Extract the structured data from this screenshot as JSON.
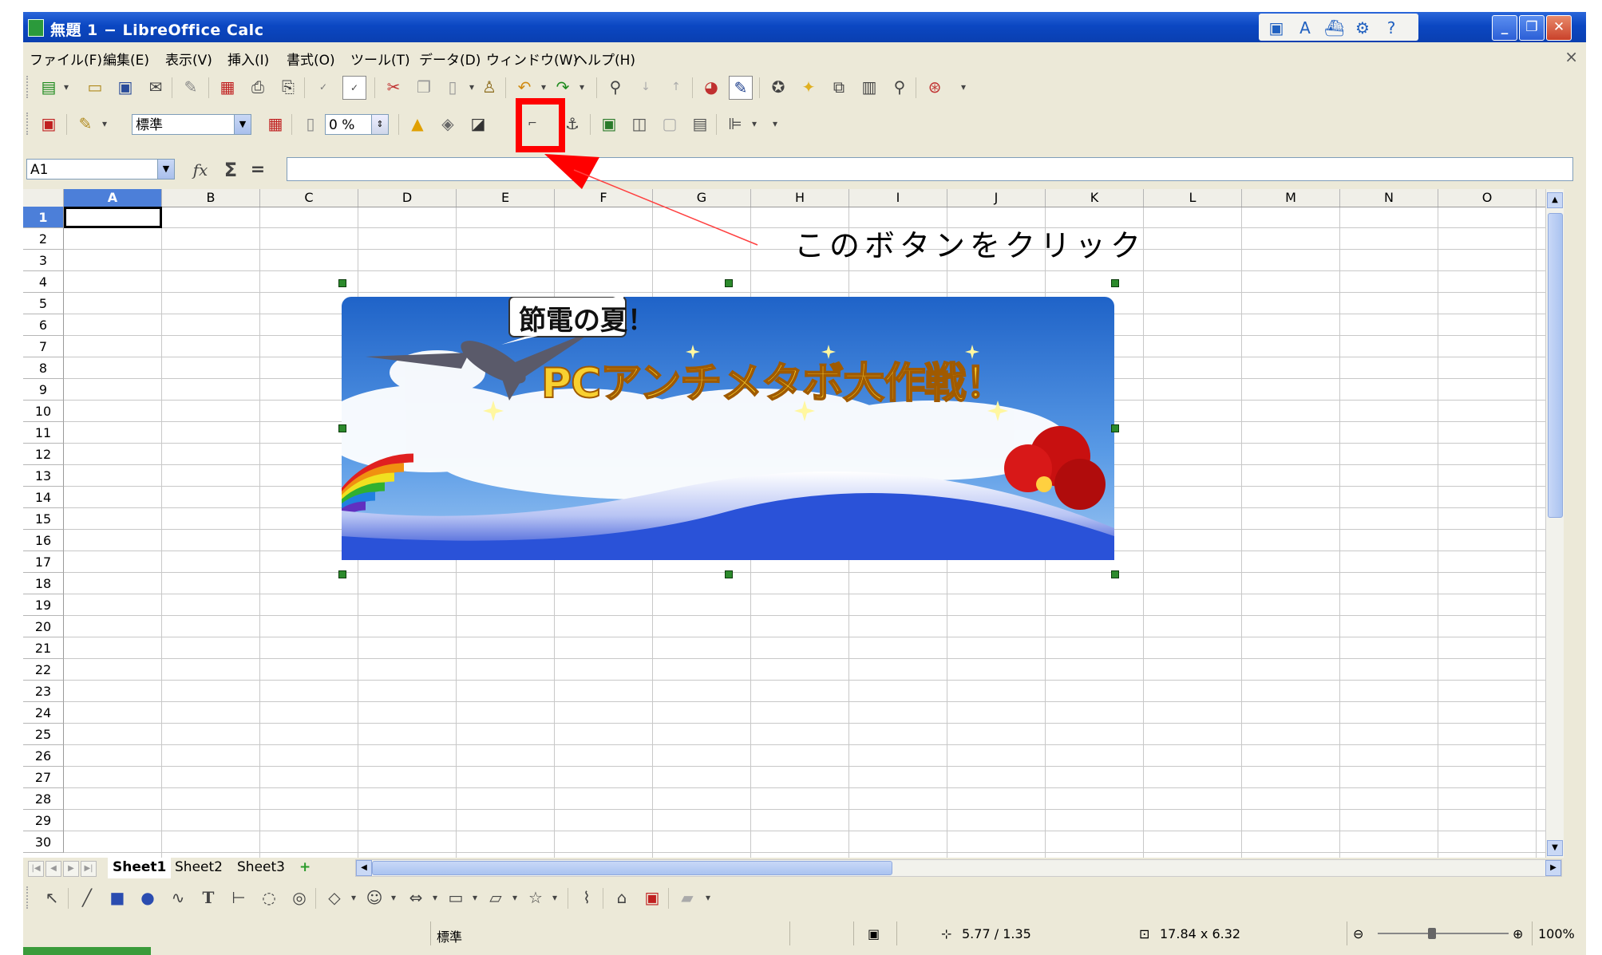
{
  "window": {
    "title": "無題 1 − LibreOffice Calc",
    "controls": {
      "minimize": "_",
      "restore": "❐",
      "close": "✕"
    }
  },
  "tray_icons": [
    "drive-icon",
    "font-icon",
    "ship-icon",
    "gear-icon",
    "help-icon"
  ],
  "menu": [
    "ファイル(F)",
    "編集(E)",
    "表示(V)",
    "挿入(I)",
    "書式(O)",
    "ツール(T)",
    "データ(D)",
    "ウィンドウ(W)",
    "ヘルプ(H)"
  ],
  "menu_close": "×",
  "image_toolbar": {
    "filter_combo": "標準",
    "transparency": "0 %"
  },
  "formula_bar": {
    "name_box": "A1",
    "function_wizard": "fx",
    "sum": "Σ",
    "equals": "=",
    "content": ""
  },
  "columns": [
    "A",
    "B",
    "C",
    "D",
    "E",
    "F",
    "G",
    "H",
    "I",
    "J",
    "K",
    "L",
    "M",
    "N",
    "O"
  ],
  "rows": [
    "1",
    "2",
    "3",
    "4",
    "5",
    "6",
    "7",
    "8",
    "9",
    "10",
    "11",
    "12",
    "13",
    "14",
    "15",
    "16",
    "17",
    "18",
    "19",
    "20",
    "21",
    "22",
    "23",
    "24",
    "25",
    "26",
    "27",
    "28",
    "29",
    "30"
  ],
  "selected_cell": "A1",
  "annotation": {
    "text": "このボタンをクリック",
    "highlight_color": "#ff0000"
  },
  "banner": {
    "speech": "節電の夏！",
    "headline": "PCアンチメタボ大作戦！"
  },
  "sheets": [
    "Sheet1",
    "Sheet2",
    "Sheet3"
  ],
  "active_sheet": "Sheet1",
  "status": {
    "style": "標準",
    "position": "5.77 / 1.35",
    "size": "17.84 x 6.32",
    "zoom": "100%"
  }
}
